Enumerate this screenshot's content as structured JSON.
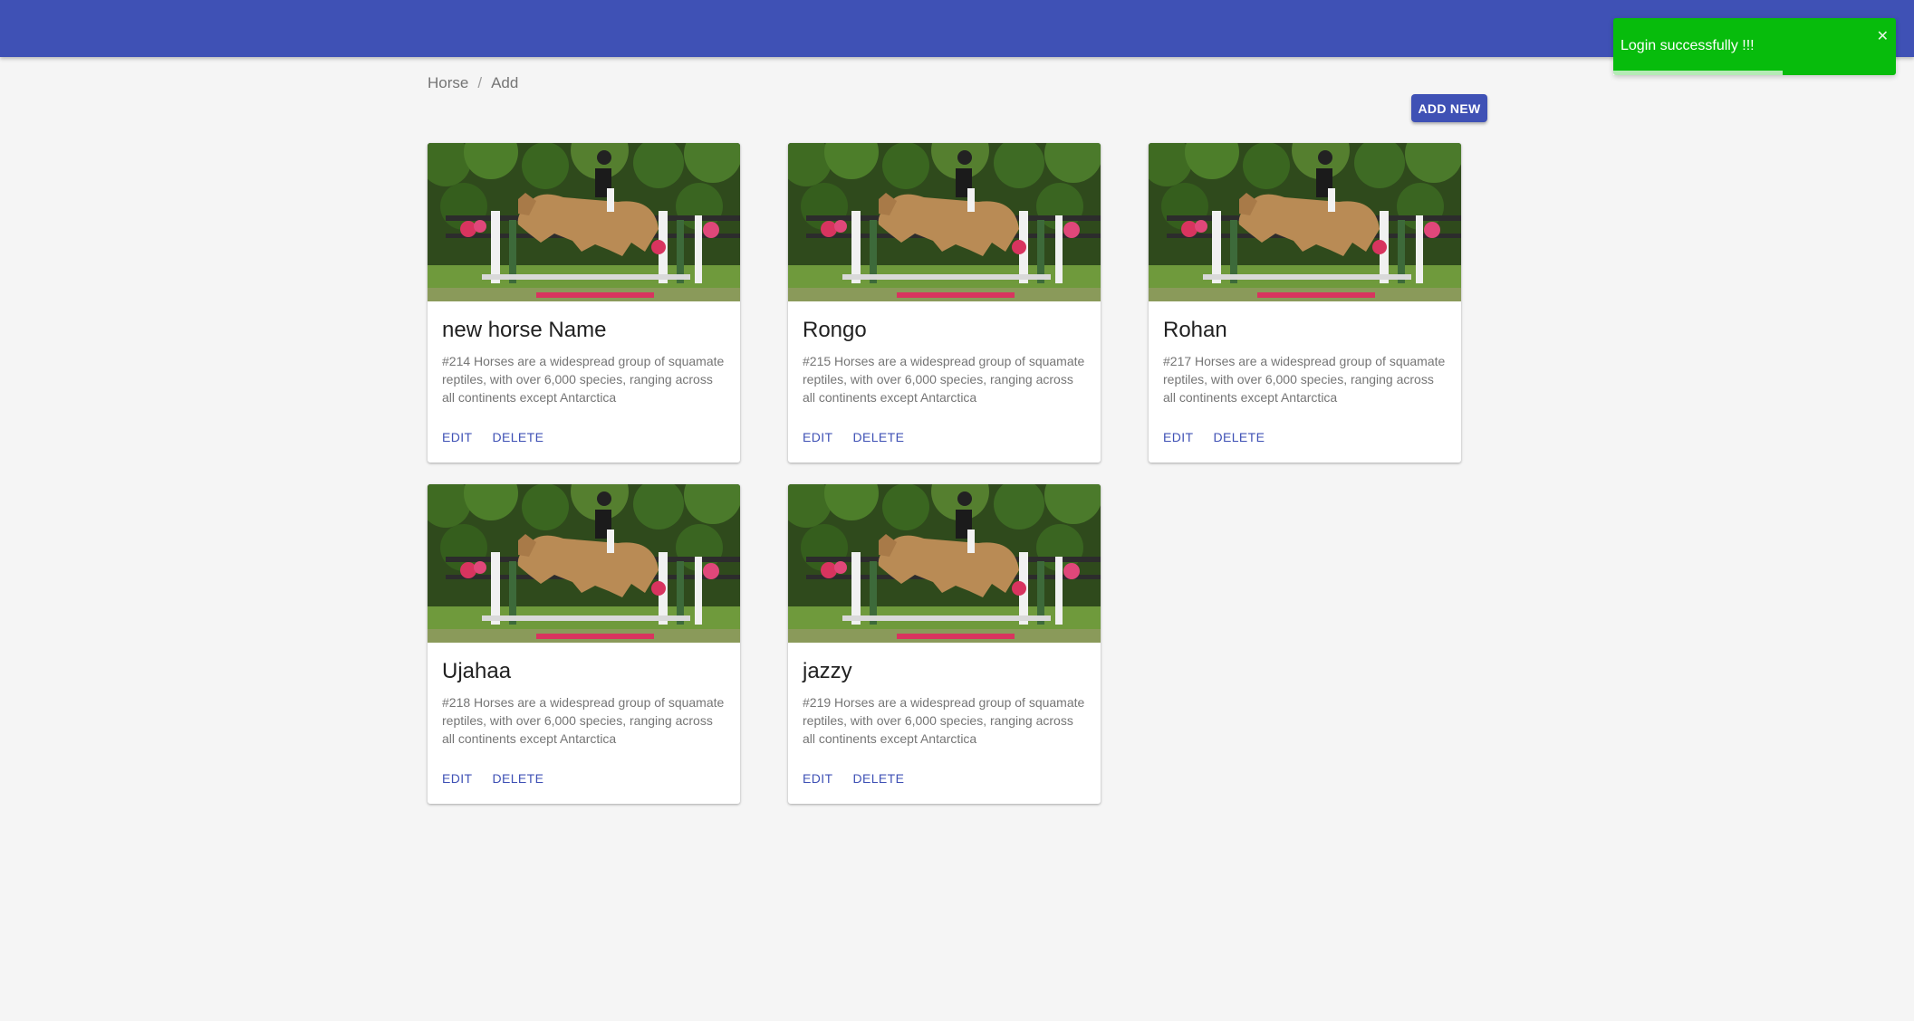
{
  "breadcrumb": {
    "items": [
      "Horse",
      "Add"
    ],
    "separator": "/"
  },
  "toolbar": {
    "add_new_label": "ADD NEW"
  },
  "colors": {
    "primary": "#3f51b5",
    "toast_success": "#07bc0c",
    "background": "#f5f5f5"
  },
  "cards": [
    {
      "name": "new horse Name",
      "description": "#214 Horses are a widespread group of squamate reptiles, with over 6,000 species, ranging across all continents except Antarctica",
      "edit_label": "EDIT",
      "delete_label": "DELETE"
    },
    {
      "name": "Rongo",
      "description": "#215 Horses are a widespread group of squamate reptiles, with over 6,000 species, ranging across all continents except Antarctica",
      "edit_label": "EDIT",
      "delete_label": "DELETE"
    },
    {
      "name": "Rohan",
      "description": "#217 Horses are a widespread group of squamate reptiles, with over 6,000 species, ranging across all continents except Antarctica",
      "edit_label": "EDIT",
      "delete_label": "DELETE"
    },
    {
      "name": "Ujahaa",
      "description": "#218 Horses are a widespread group of squamate reptiles, with over 6,000 species, ranging across all continents except Antarctica",
      "edit_label": "EDIT",
      "delete_label": "DELETE"
    },
    {
      "name": "jazzy",
      "description": "#219 Horses are a widespread group of squamate reptiles, with over 6,000 species, ranging across all continents except Antarctica",
      "edit_label": "EDIT",
      "delete_label": "DELETE"
    }
  ],
  "toast": {
    "message": "Login successfully !!!",
    "close_icon": "close-icon",
    "progress": 0.6
  }
}
